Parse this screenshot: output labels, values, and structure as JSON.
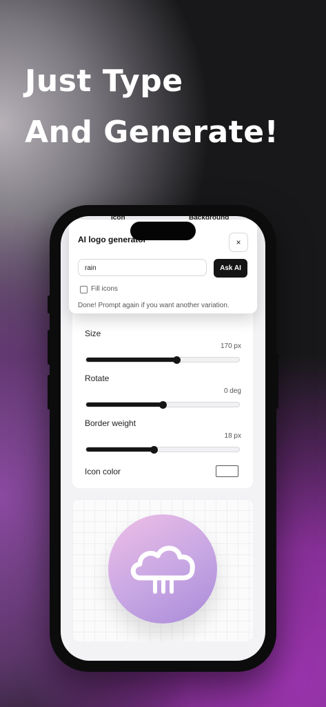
{
  "headline": {
    "line1": "Just Type",
    "line2": "And Generate!"
  },
  "tabs": {
    "icon": "Icon",
    "background": "Background"
  },
  "modal": {
    "title": "AI logo generator",
    "close_label": "×",
    "prompt_value": "rain",
    "ask_label": "Ask AI",
    "fill_icons_label": "Fill icons",
    "fill_icons_checked": false,
    "status": "Done! Prompt again if you want another variation."
  },
  "settings": {
    "size": {
      "label": "Size",
      "value": "170 px",
      "fraction": 0.59
    },
    "rotate": {
      "label": "Rotate",
      "value": "0 deg",
      "fraction": 0.5
    },
    "border_weight": {
      "label": "Border weight",
      "value": "18 px",
      "fraction": 0.44
    },
    "icon_color": {
      "label": "Icon color",
      "color": "#ffffff"
    }
  },
  "preview": {
    "icon": "cloud-rain-icon",
    "gradient": [
      "#eebfe6",
      "#a98ad8"
    ]
  },
  "colors": {
    "accent": "#151515",
    "background_purple": "#9a34ad"
  }
}
